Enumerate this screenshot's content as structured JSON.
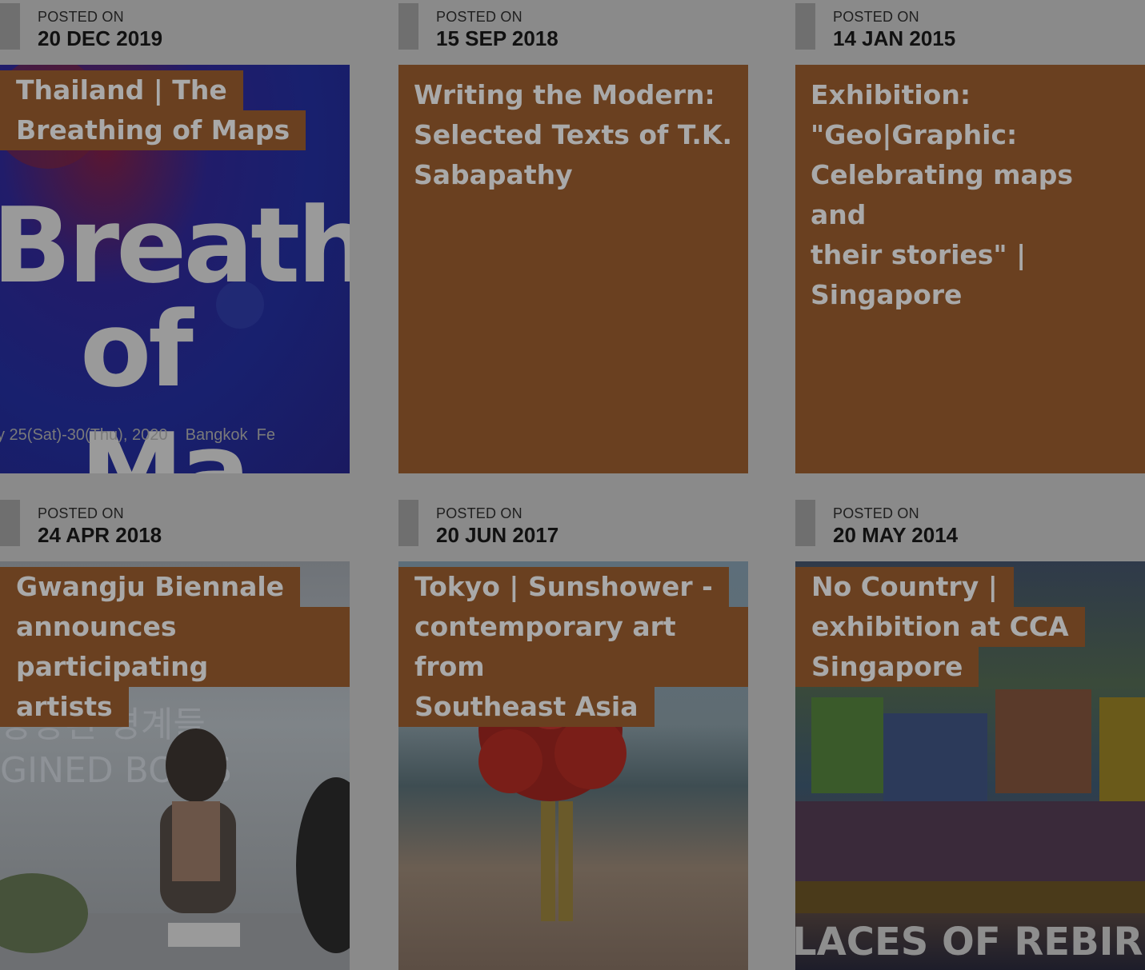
{
  "posts": [
    {
      "posted_label": "POSTED ON",
      "date": "20 DEC 2019",
      "title_lines": [
        "Thailand | The",
        "Breathing of Maps"
      ],
      "image_text": [
        "Breathin",
        "of Ma",
        "y 25(Sat)-30(Thu), 2020    Bangkok  Fe"
      ]
    },
    {
      "posted_label": "POSTED ON",
      "date": "15 SEP 2018",
      "title_lines": [
        "Writing the Modern:",
        "Selected Texts of T.K.",
        "Sabapathy"
      ]
    },
    {
      "posted_label": "POSTED ON",
      "date": "14 JAN 2015",
      "title_lines": [
        "Exhibition:",
        "\"Geo|Graphic:",
        "Celebrating maps and",
        "their stories\" |",
        "Singapore"
      ]
    },
    {
      "posted_label": "POSTED ON",
      "date": "24 APR 2018",
      "title_lines": [
        "Gwangju Biennale",
        "announces participating",
        "artists"
      ],
      "image_text": [
        "상상된 경계들",
        "GINED BO   S"
      ]
    },
    {
      "posted_label": "POSTED ON",
      "date": "20 JUN 2017",
      "title_lines": [
        "Tokyo | Sunshower -",
        "contemporary art from",
        "Southeast Asia"
      ]
    },
    {
      "posted_label": "POSTED ON",
      "date": "20 MAY 2014",
      "title_lines": [
        "No Country |",
        "exhibition at CCA",
        "Singapore"
      ],
      "image_text": [
        "LACES OF REBIR"
      ]
    }
  ]
}
